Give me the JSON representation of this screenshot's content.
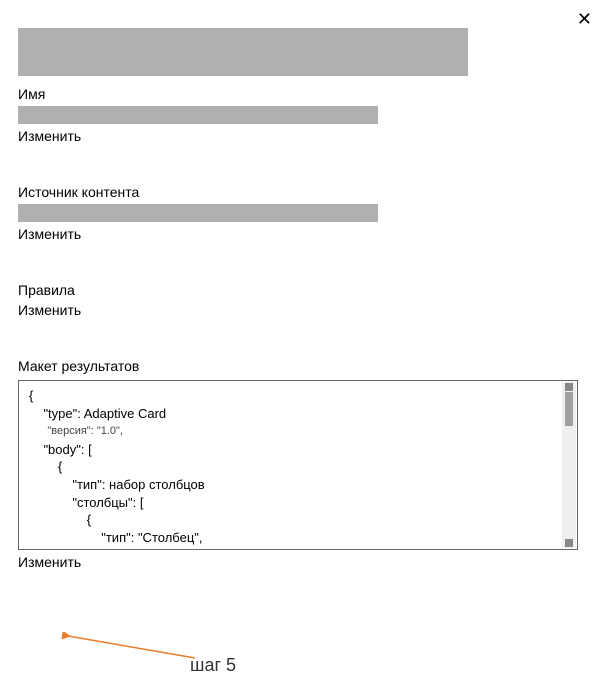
{
  "close_symbol": "✕",
  "top": {},
  "name": {
    "label": "Имя",
    "edit_label": "Изменить"
  },
  "content_source": {
    "label": "Источник контента",
    "edit_label": "Изменить"
  },
  "rules": {
    "label": "Правила",
    "edit_label": "Изменить"
  },
  "layout": {
    "label": "Макет результатов",
    "edit_label": "Изменить",
    "json_lines": {
      "l1": "{",
      "l2": "    \"type\": Adaptive Card",
      "l3": "      \"версия\": \"1.0\",",
      "l4": "    \"body\": [",
      "l5": "        {",
      "l6": "            \"тип\": набор столбцов",
      "l7": "            \"столбцы\": [",
      "l8": "                {",
      "l9": "                    \"тип\": \"Столбец\","
    }
  },
  "annotation": {
    "step_label": "шаг 5"
  },
  "colors": {
    "placeholder": "#b0b0b0",
    "arrow": "#e97c2b"
  }
}
